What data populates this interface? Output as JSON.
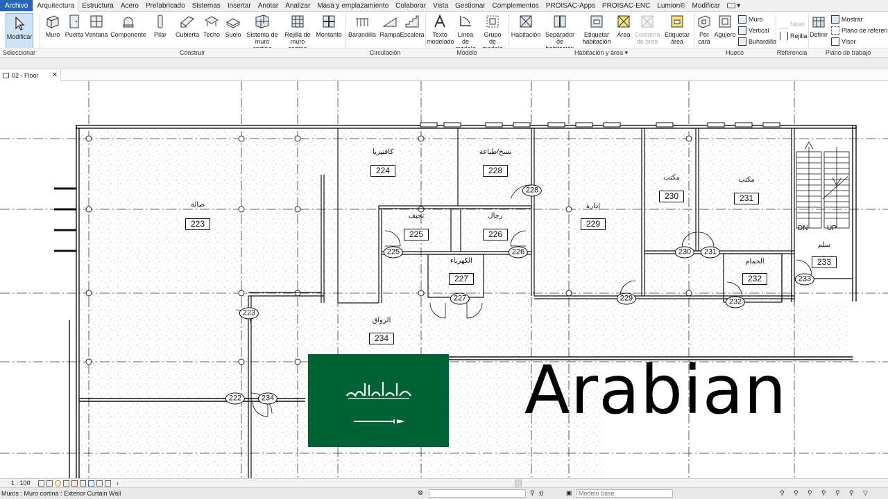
{
  "tabs": [
    "Archivo",
    "Arquitectura",
    "Estructura",
    "Acero",
    "Prefabricado",
    "Sistemas",
    "Insertar",
    "Anotar",
    "Analizar",
    "Masa y emplazamiento",
    "Colaborar",
    "Vista",
    "Gestionar",
    "Complementos",
    "PROISAC-Apps",
    "PROISAC-ENC",
    "Lumion®",
    "Modificar"
  ],
  "active_tab": "Arquitectura",
  "ribbon": {
    "modify": "Modificar",
    "build": [
      "Muro",
      "Puerta",
      "Ventana",
      "Componente",
      "Pilar",
      "Cubierta",
      "Techo",
      "Suelo"
    ],
    "curtain_system": "Sistema de muro cortina",
    "curtain_grid": "Rejilla de muro cortina",
    "mullion": "Montante",
    "circulation": [
      "Barandilla",
      "Rampa",
      "Escalera"
    ],
    "model_text": "Texto modelado",
    "model_line": "Línea de modelo",
    "model_group": "Grupo de modelo",
    "room": "Habitación",
    "room_separator": "Separador de habitación",
    "tag_room": "Etiquetar habitación",
    "area": "Área",
    "area_boundary": "Contorno de área",
    "tag_area": "Etiquetar área",
    "by_face": "Por cara",
    "shaft": "Agujero",
    "opening_small": [
      "Muro",
      "Vertical",
      "Buhardilla"
    ],
    "level": "Nivel",
    "grid": "Rejilla",
    "set": "Definir",
    "workplane_small": [
      "Mostrar",
      "Plano de referencia",
      "Visor"
    ]
  },
  "panels": {
    "select": "Seleccionar ▾",
    "build": "Construir",
    "circulation": "Circulación",
    "model": "Modelo",
    "room_area": "Habitación y área ▾",
    "opening": "Hueco",
    "datum": "Referencia",
    "workplane": "Plano de trabajo"
  },
  "view_tab": {
    "title": "02 - Floor",
    "close": "✕"
  },
  "rooms": [
    {
      "name": "صالة",
      "number": "223"
    },
    {
      "name": "كافتيريا",
      "number": "224"
    },
    {
      "name": "نسخ/طباعة",
      "number": "228"
    },
    {
      "name": "إدارة",
      "number": "229"
    },
    {
      "name": "مكتب",
      "number": "230"
    },
    {
      "name": "مكتب",
      "number": "231"
    },
    {
      "name": "نجيف",
      "number": "225"
    },
    {
      "name": "رجال",
      "number": "226"
    },
    {
      "name": "الكهرباء",
      "number": "227"
    },
    {
      "name": "الحمام",
      "number": "232"
    },
    {
      "name": "سلم",
      "number": "233"
    },
    {
      "name": "الرواق",
      "number": "234"
    }
  ],
  "door_tags": [
    "228",
    "225",
    "226",
    "227",
    "230",
    "231",
    "229",
    "233",
    "232",
    "223",
    "222",
    "234"
  ],
  "stair_labels": [
    "DN",
    "UP"
  ],
  "overlay": {
    "title": "Arabian"
  },
  "view_control": {
    "scale": "1 : 100"
  },
  "status": {
    "message": "Muros : Muro cortina : Exterior Curtain Wall",
    "count": ":0",
    "base_model": "Modelo base"
  },
  "colors": {
    "accent_blue": "#2a64b8",
    "flag_green": "#006337",
    "modify_highlight": "#cfe3f7"
  }
}
